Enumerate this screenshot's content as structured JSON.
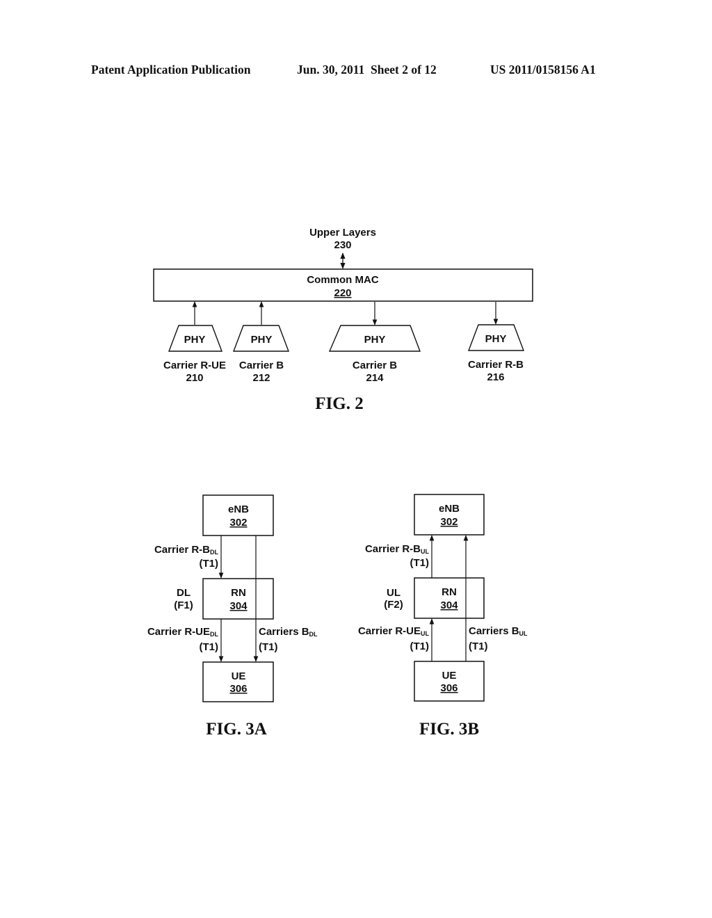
{
  "header": {
    "publication": "Patent Application Publication",
    "date_sheet": "Jun. 30, 2011  Sheet 2 of 12",
    "number": "US 2011/0158156 A1"
  },
  "fig2": {
    "caption": "FIG. 2",
    "upper_layers": {
      "label": "Upper Layers",
      "ref": "230"
    },
    "common_mac": {
      "label": "Common MAC",
      "ref": "220"
    },
    "phys": [
      {
        "label": "PHY",
        "carrier": "Carrier R-UE",
        "ref": "210",
        "direction": "up"
      },
      {
        "label": "PHY",
        "carrier": "Carrier B",
        "ref": "212",
        "direction": "up"
      },
      {
        "label": "PHY",
        "carrier": "Carrier B",
        "ref": "214",
        "direction": "down"
      },
      {
        "label": "PHY",
        "carrier": "Carrier R-B",
        "ref": "216",
        "direction": "down"
      }
    ]
  },
  "fig3a": {
    "caption": "FIG. 3A",
    "enb": {
      "label": "eNB",
      "ref": "302"
    },
    "rn": {
      "label": "RN",
      "ref": "304"
    },
    "ue": {
      "label": "UE",
      "ref": "306"
    },
    "side_label": {
      "line1": "DL",
      "line2": "(F1)"
    },
    "link_rb": {
      "main": "Carrier R-B",
      "sub": "DL",
      "slot": "(T1)"
    },
    "link_rue": {
      "main": "Carrier R-UE",
      "sub": "DL",
      "slot": "(T1)"
    },
    "link_b": {
      "main": "Carriers B",
      "sub": "DL",
      "slot": "(T1)"
    }
  },
  "fig3b": {
    "caption": "FIG. 3B",
    "enb": {
      "label": "eNB",
      "ref": "302"
    },
    "rn": {
      "label": "RN",
      "ref": "304"
    },
    "ue": {
      "label": "UE",
      "ref": "306"
    },
    "side_label": {
      "line1": "UL",
      "line2": "(F2)"
    },
    "link_rb": {
      "main": "Carrier R-B",
      "sub": "UL",
      "slot": "(T1)"
    },
    "link_rue": {
      "main": "Carrier R-UE",
      "sub": "UL",
      "slot": "(T1)"
    },
    "link_b": {
      "main": "Carriers B",
      "sub": "UL",
      "slot": "(T1)"
    }
  }
}
